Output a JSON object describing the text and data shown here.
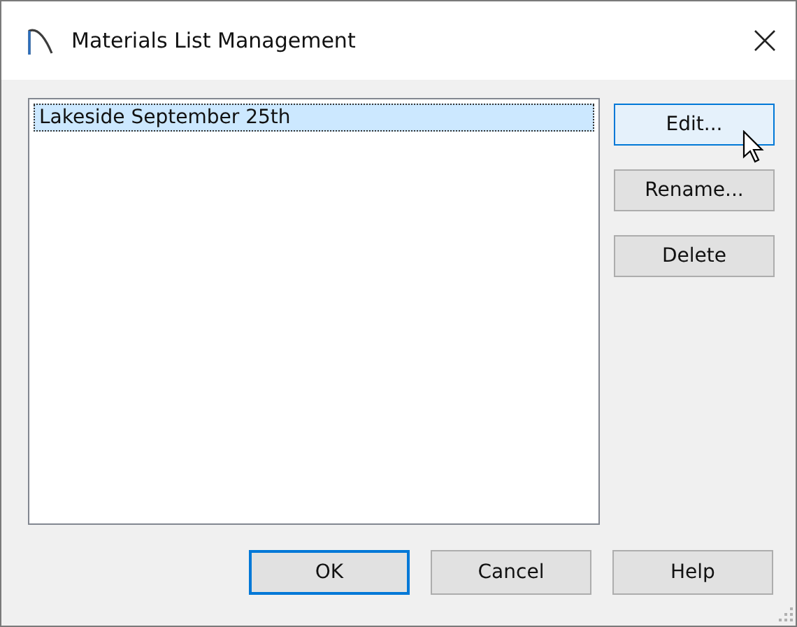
{
  "window": {
    "title": "Materials List Management"
  },
  "list": {
    "items": [
      {
        "label": "Lakeside September 25th",
        "selected": true
      }
    ]
  },
  "side_buttons": [
    {
      "label": "Edit...",
      "hovered": true
    },
    {
      "label": "Rename...",
      "hovered": false
    },
    {
      "label": "Delete",
      "hovered": false
    }
  ],
  "footer_buttons": [
    {
      "label": "OK",
      "default": true
    },
    {
      "label": "Cancel",
      "default": false
    },
    {
      "label": "Help",
      "default": false
    }
  ]
}
